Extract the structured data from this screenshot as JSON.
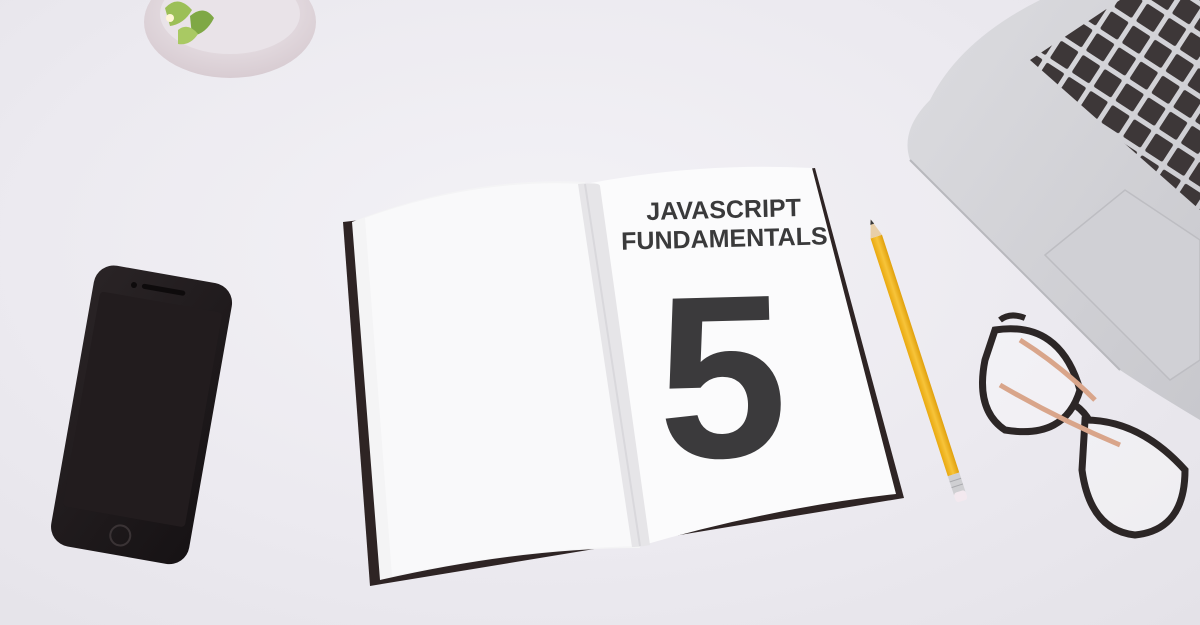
{
  "notebook": {
    "title_line1": "JAVASCRIPT",
    "title_line2": "FUNDAMENTALS",
    "number": "5"
  },
  "colors": {
    "background": "#eceaf0",
    "text": "#3a3a3b",
    "pencil": "#f2b51e",
    "phone": "#1e1a1c"
  }
}
